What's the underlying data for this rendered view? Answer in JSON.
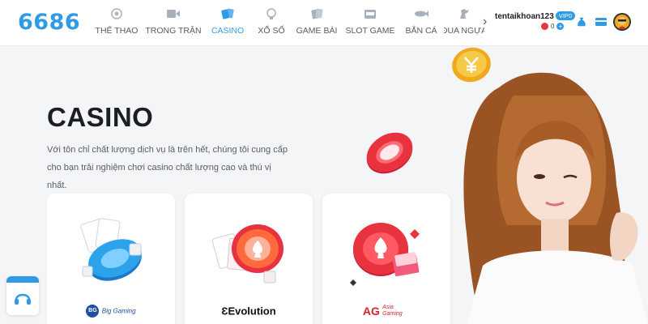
{
  "header": {
    "logo": "6686",
    "nav": [
      {
        "label": "THỂ THAO",
        "icon": "soccer-ball-icon"
      },
      {
        "label": "TRONG TRẬN",
        "icon": "video-icon"
      },
      {
        "label": "CASINO",
        "icon": "cards-icon",
        "active": true
      },
      {
        "label": "XỔ SỐ",
        "icon": "lottery-icon"
      },
      {
        "label": "GAME BÀI",
        "icon": "card-game-icon"
      },
      {
        "label": "SLOT GAME",
        "icon": "slot-machine-icon"
      },
      {
        "label": "BẮN CÁ",
        "icon": "fish-icon"
      },
      {
        "label": "ĐUA NGỰA",
        "icon": "horse-icon"
      }
    ],
    "user": {
      "name": "tentaikhoan123",
      "vip": "VIP0",
      "balance": "0"
    }
  },
  "hero": {
    "title": "CASINO",
    "description": "Với tôn chỉ chất lượng dịch vụ là trên hết, chúng tôi cung cấp cho bạn trải nghiệm chơi casino chất lượng cao và thú vị nhất."
  },
  "providers": [
    {
      "brand": "Big Gaming",
      "badge": "BG"
    },
    {
      "brand": "Evolution",
      "badge": "Ɛ"
    },
    {
      "brand": "Asia Gaming",
      "badge": "AG"
    }
  ],
  "colors": {
    "accent": "#2f9be6",
    "text": "#1b1e24",
    "chip_red": "#e8323e"
  }
}
